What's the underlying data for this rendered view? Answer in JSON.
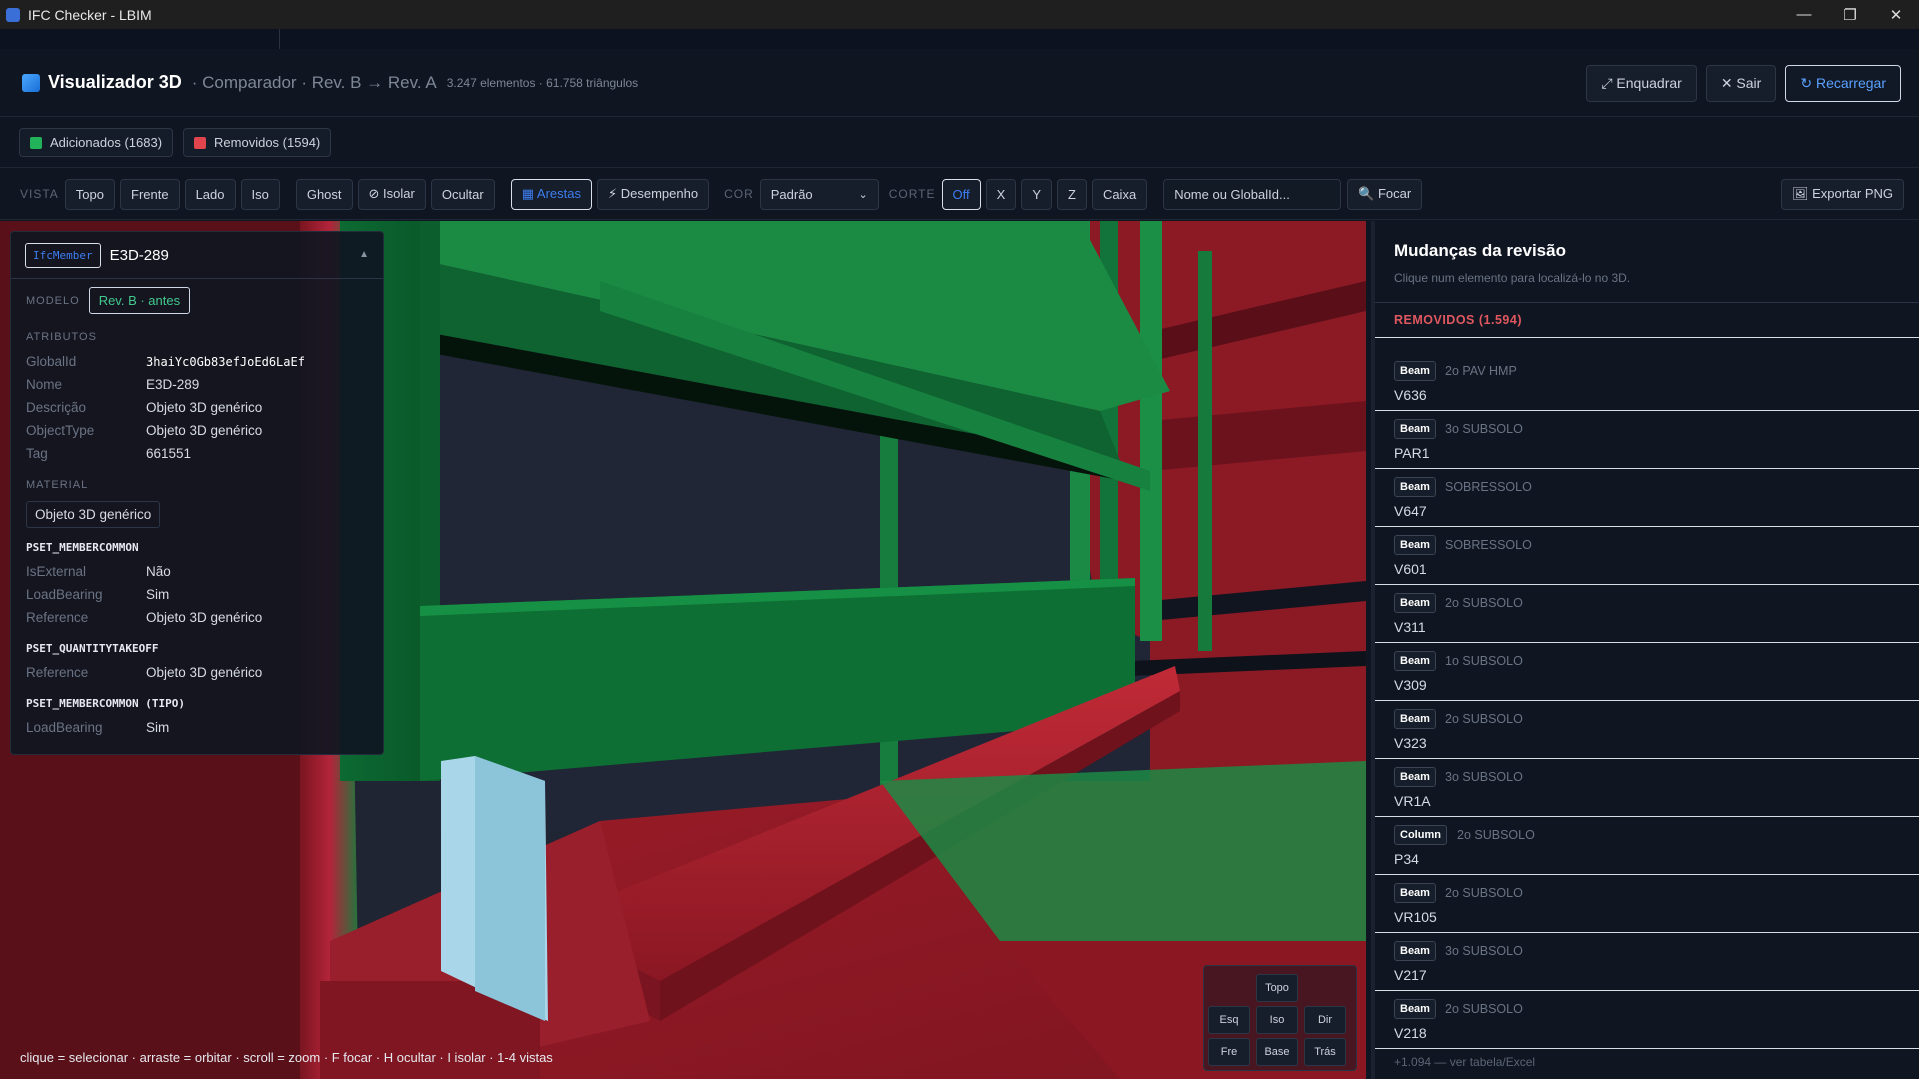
{
  "window": {
    "title": "IFC Checker - LBIM"
  },
  "header": {
    "title": "Visualizador 3D",
    "subtitle": "· Comparador · Rev. B → Rev. A",
    "stats": "3.247 elementos · 61.758 triângulos",
    "frame_label": "⤢ Enquadrar",
    "exit_label": "✕ Sair",
    "reload_label": "↻ Recarregar"
  },
  "legend": {
    "added": {
      "label": "Adicionados (1683)",
      "color": "#22b35a"
    },
    "removed": {
      "label": "Removidos (1594)",
      "color": "#e0444d"
    }
  },
  "toolbar": {
    "view_label": "VISTA",
    "views": [
      "Topo",
      "Frente",
      "Lado",
      "Iso"
    ],
    "ghost": "Ghost",
    "isolate": "⊘ Isolar",
    "hide": "Ocultar",
    "edges": "▦ Arestas",
    "performance": "⚡ Desempenho",
    "color_label": "COR",
    "color_value": "Padrão",
    "cut_label": "CORTE",
    "cut_options": [
      "Off",
      "X",
      "Y",
      "Z",
      "Caixa"
    ],
    "search_placeholder": "Nome ou GlobalId...",
    "focus": "🔍 Focar",
    "export": "🖼 Exportar PNG"
  },
  "properties": {
    "type": "IfcMember",
    "name": "E3D-289",
    "collapse": "▲",
    "model_label": "MODELO",
    "model_value": "Rev. B · antes",
    "attributes_title": "ATRIBUTOS",
    "attributes": [
      {
        "k": "GlobalId",
        "v": "3haiYc0Gb83efJoEd6LaEf"
      },
      {
        "k": "Nome",
        "v": "E3D-289"
      },
      {
        "k": "Descrição",
        "v": "Objeto 3D genérico"
      },
      {
        "k": "ObjectType",
        "v": "Objeto 3D genérico"
      },
      {
        "k": "Tag",
        "v": "661551"
      }
    ],
    "material_title": "MATERIAL",
    "material": "Objeto 3D genérico",
    "psets": [
      {
        "title": "PSET_MEMBERCOMMON",
        "rows": [
          {
            "k": "IsExternal",
            "v": "Não"
          },
          {
            "k": "LoadBearing",
            "v": "Sim"
          },
          {
            "k": "Reference",
            "v": "Objeto 3D genérico"
          }
        ]
      },
      {
        "title": "PSET_QUANTITYTAKEOFF",
        "rows": [
          {
            "k": "Reference",
            "v": "Objeto 3D genérico"
          }
        ]
      },
      {
        "title": "PSET_MEMBERCOMMON (TIPO)",
        "rows": [
          {
            "k": "LoadBearing",
            "v": "Sim"
          }
        ]
      }
    ]
  },
  "hint": "clique = selecionar · arraste = orbitar · scroll = zoom · F focar · H ocultar · I isolar · 1-4 vistas",
  "navcube": {
    "top": "Topo",
    "left": "Esq",
    "iso": "Iso",
    "right": "Dir",
    "front": "Fre",
    "base": "Base",
    "back": "Trás"
  },
  "changes": {
    "title": "Mudanças da revisão",
    "subtitle": "Clique num elemento para localizá-lo no 3D.",
    "group": "REMOVIDOS (1.594)",
    "items": [
      {
        "type": "Beam",
        "level": "2o PAV HMP",
        "name": "V636"
      },
      {
        "type": "Beam",
        "level": "3o SUBSOLO",
        "name": "PAR1"
      },
      {
        "type": "Beam",
        "level": "SOBRESSOLO",
        "name": "V647"
      },
      {
        "type": "Beam",
        "level": "SOBRESSOLO",
        "name": "V601"
      },
      {
        "type": "Beam",
        "level": "2o SUBSOLO",
        "name": "V311"
      },
      {
        "type": "Beam",
        "level": "1o SUBSOLO",
        "name": "V309"
      },
      {
        "type": "Beam",
        "level": "2o SUBSOLO",
        "name": "V323"
      },
      {
        "type": "Beam",
        "level": "3o SUBSOLO",
        "name": "VR1A"
      },
      {
        "type": "Column",
        "level": "2o SUBSOLO",
        "name": "P34"
      },
      {
        "type": "Beam",
        "level": "2o SUBSOLO",
        "name": "VR105"
      },
      {
        "type": "Beam",
        "level": "3o SUBSOLO",
        "name": "V217"
      },
      {
        "type": "Beam",
        "level": "2o SUBSOLO",
        "name": "V218"
      }
    ],
    "more": "+1.094 — ver tabela/Excel"
  }
}
